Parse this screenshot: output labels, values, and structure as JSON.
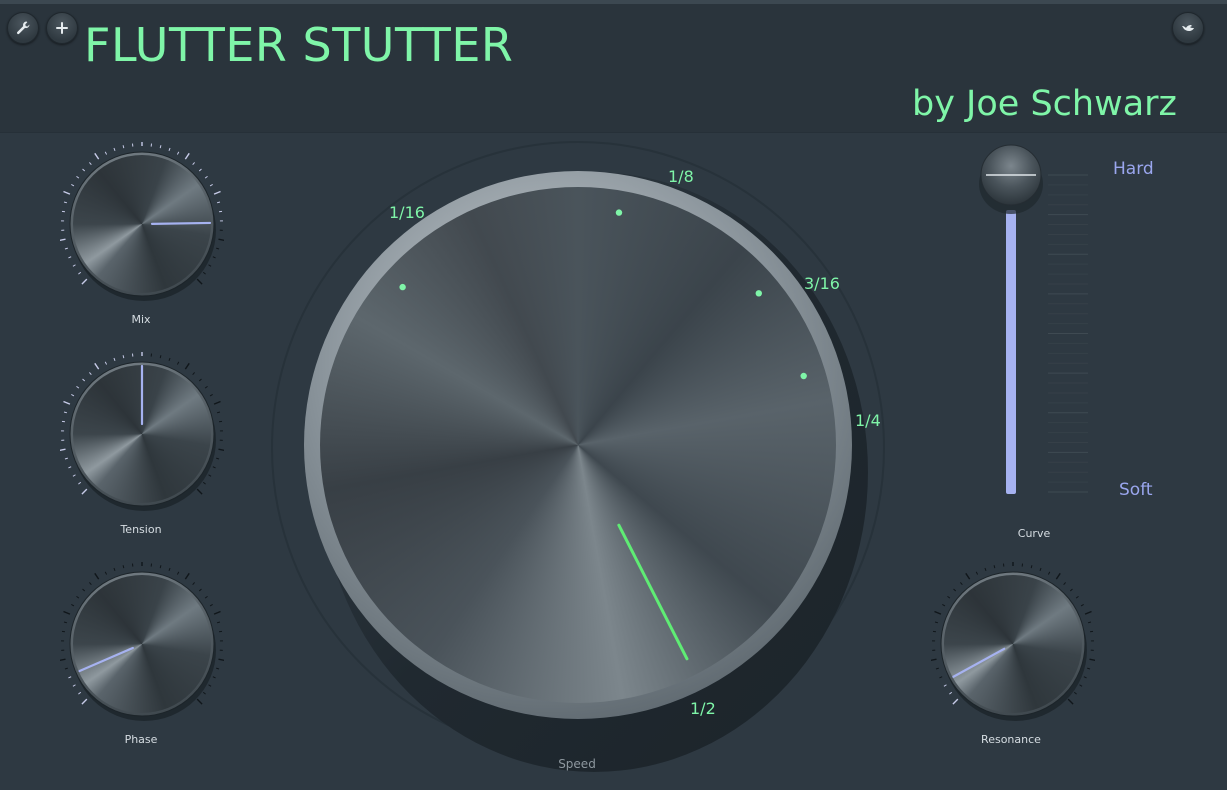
{
  "header": {
    "title": "FLUTTER STUTTER",
    "author": "by Joe Schwarz",
    "icons": [
      "wrench-icon",
      "plus-icon",
      "bird-icon"
    ]
  },
  "knobs": {
    "mix": {
      "label": "Mix",
      "value": 0.83
    },
    "tension": {
      "label": "Tension",
      "value": 0.5
    },
    "phase": {
      "label": "Phase",
      "value": 0.08
    },
    "resonance": {
      "label": "Resonance",
      "value": 0.06
    }
  },
  "speed": {
    "label": "Speed",
    "rates": [
      "1/16",
      "1/8",
      "3/16",
      "1/4",
      "1/2"
    ],
    "selected": "1/2"
  },
  "curve": {
    "label": "Curve",
    "top_label": "Hard",
    "bottom_label": "Soft",
    "value": 1.0
  },
  "colors": {
    "accent_green": "#7ff5a8",
    "pointer_blue": "#a6b2f0",
    "background": "#2e3942"
  }
}
